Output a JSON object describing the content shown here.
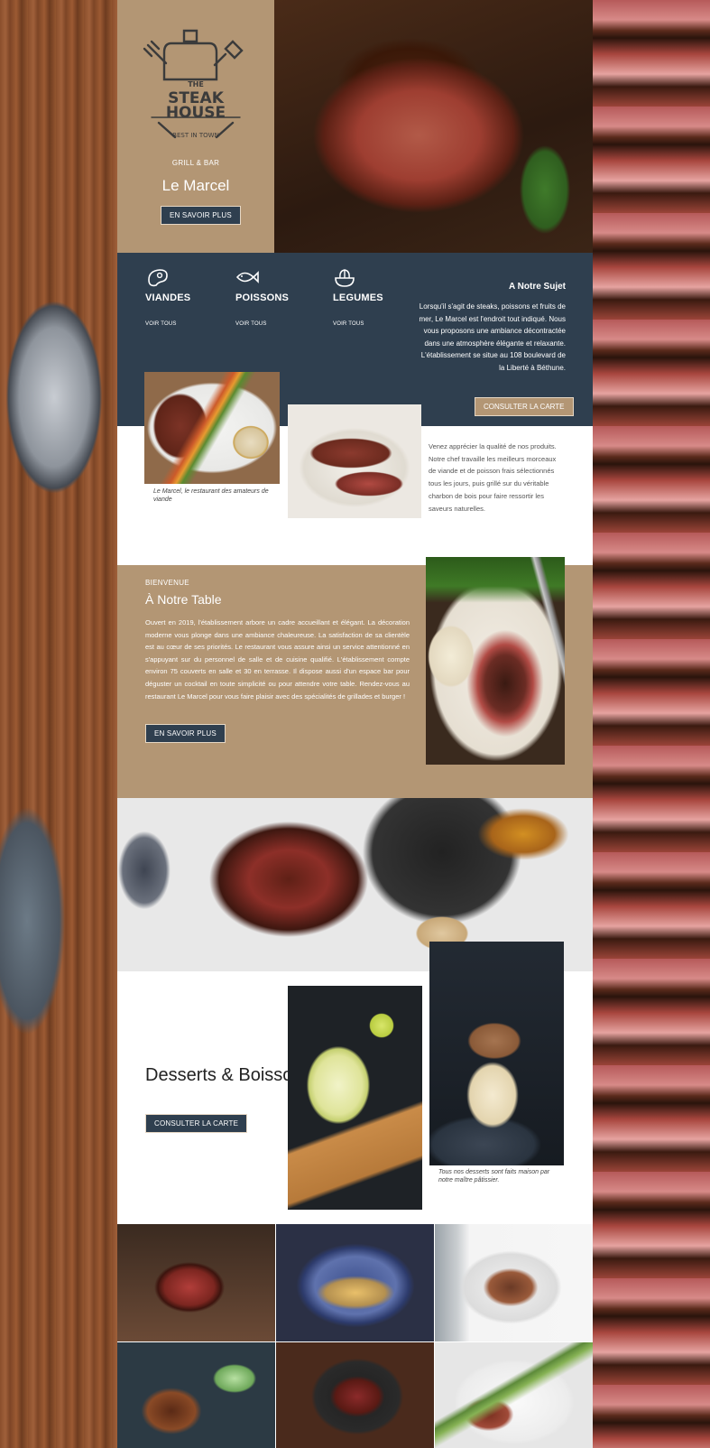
{
  "hero": {
    "logo": {
      "line1": "THE",
      "line2": "STEAK",
      "line3": "HOUSE",
      "tagline": "BEST IN TOWN"
    },
    "subtitle": "GRILL & BAR",
    "name": "Le Marcel",
    "cta": "EN SAVOIR PLUS"
  },
  "categories": [
    {
      "icon": "steak-icon",
      "title": "VIANDES",
      "link": "VOIR TOUS"
    },
    {
      "icon": "fish-icon",
      "title": "POISSONS",
      "link": "VOIR TOUS"
    },
    {
      "icon": "vegetable-icon",
      "title": "LEGUMES",
      "link": "VOIR TOUS"
    }
  ],
  "about": {
    "title": "A Notre Sujet",
    "text": "Lorsqu'il s'agit de steaks, poissons et fruits de mer, Le Marcel est l'endroit tout indiqué. Nous vous proposons une ambiance décontractée dans une atmosphère élégante et relaxante. L'établissement se situe au 108 boulevard de la Liberté à Béthune.",
    "cta": "CONSULTER LA CARTE"
  },
  "menu_intro": {
    "caption": "Le Marcel, le restaurant des amateurs de viande",
    "text": "Venez apprécier la qualité de nos produits. Notre chef travaille les meilleurs morceaux de viande et de poisson frais sélectionnés tous les jours, puis grillé sur du véritable charbon de bois pour faire ressortir les saveurs naturelles."
  },
  "welcome": {
    "kicker": "BIENVENUE",
    "title": "À Notre Table",
    "text": "Ouvert en 2019, l'établissement arbore un cadre accueillant et élégant. La décoration moderne vous plonge dans une ambiance chaleureuse. La satisfaction de sa clientèle est au cœur de ses priorités. Le restaurant vous assure ainsi un service attentionné en s'appuyant sur du personnel de salle et de cuisine qualifié. L'établissement compte environ 75 couverts en salle et 30 en terrasse. Il dispose aussi d'un espace bar pour déguster un cocktail en toute simplicité ou pour attendre votre table. Rendez-vous au restaurant Le Marcel pour vous faire plaisir avec des spécialités de grillades et burger !",
    "cta": "EN SAVOIR PLUS"
  },
  "desserts": {
    "title": "Desserts & Boissons",
    "cta": "CONSULTER LA CARTE",
    "caption": "Tous nos desserts sont faits maison par notre maître pâtissier."
  },
  "colors": {
    "tan": "#b39674",
    "navy": "#2f3f4f",
    "white": "#ffffff"
  }
}
